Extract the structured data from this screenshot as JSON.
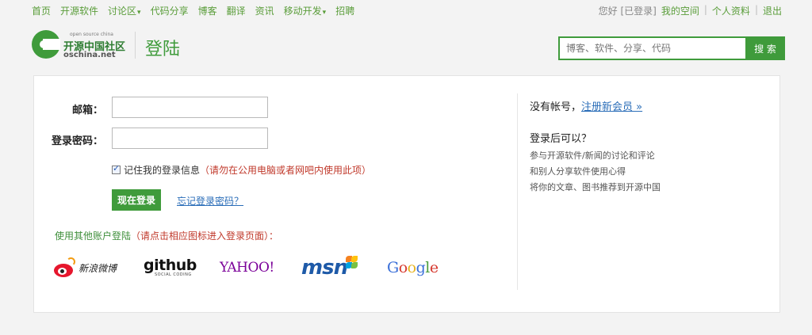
{
  "topnav": {
    "items": [
      "首页",
      "开源软件",
      "讨论区",
      "代码分享",
      "博客",
      "翻译",
      "资讯",
      "移动开发",
      "招聘"
    ],
    "right": {
      "greeting": "您好 [已登录]",
      "my_space": "我的空间",
      "profile": "个人资料",
      "logout": "退出"
    }
  },
  "header": {
    "logo_small": "open source china",
    "logo_main": "开源中国社区",
    "logo_sub": "oschina.net",
    "title": "登陆",
    "search_placeholder": "博客、软件、分享、代码",
    "search_button": "搜 索"
  },
  "form": {
    "email_label": "邮箱：",
    "password_label": "登录密码：",
    "email_value": "",
    "password_value": "",
    "remember_label": "记住我的登录信息",
    "remember_warning": "（请勿在公用电脑或者网吧内使用此项）",
    "remember_checked": true,
    "login_button": "现在登录",
    "forgot_link": "忘记登录密码？",
    "other_login_prefix": "使用其他账户登陆",
    "other_login_hint": "（请点击相应图标进入登录页面）："
  },
  "providers": {
    "weibo": "新浪微博",
    "github": "github",
    "github_sub": "SOCIAL CODING",
    "yahoo": "YAHOO!",
    "msn": "msn",
    "google": [
      "G",
      "o",
      "o",
      "g",
      "l",
      "e"
    ]
  },
  "side": {
    "no_account": "没有帐号，",
    "register_link": "注册新会员 »",
    "after_login_title": "登录后可以？",
    "benefits": [
      "参与开源软件/新闻的讨论和评论",
      "和别人分享软件使用心得",
      "将你的文章、图书推荐到开源中国"
    ]
  },
  "colors": {
    "brand_green": "#3f9b3b",
    "link_blue": "#2a6db8",
    "warning_red": "#c0392b"
  }
}
